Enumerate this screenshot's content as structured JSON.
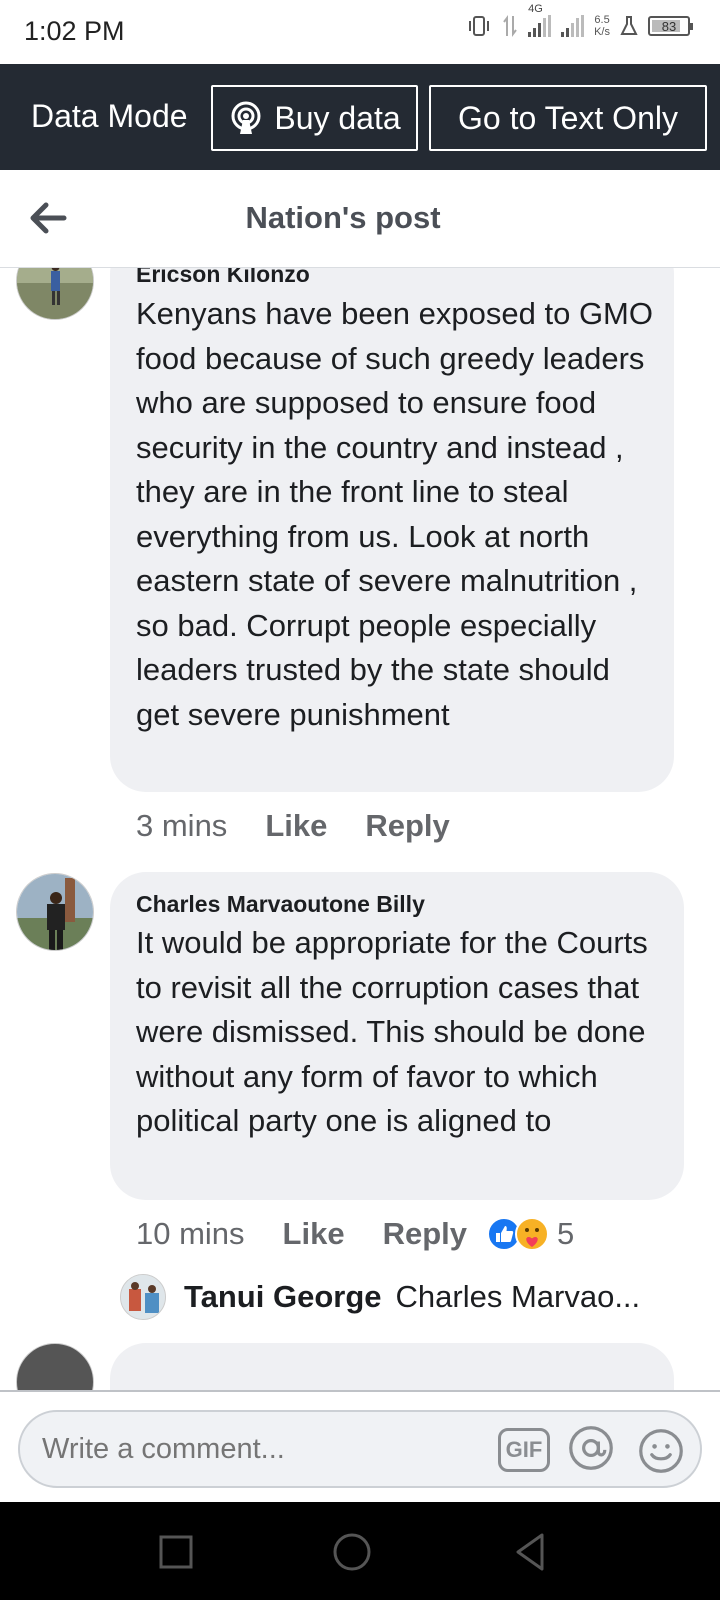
{
  "status_bar": {
    "time": "1:02 PM",
    "network": "4G",
    "speed_value": "6.5",
    "speed_unit": "K/s",
    "battery": "83",
    "battery_level": 0.83
  },
  "data_banner": {
    "mode_label": "Data Mode",
    "buy_label": "Buy data",
    "text_only_label": "Go to Text Only"
  },
  "header": {
    "title": "Nation's post"
  },
  "comments": [
    {
      "author": "Ericson Kilonzo",
      "text": "Kenyans have been exposed to GMO food because of such greedy leaders who are supposed to ensure food security in the country and instead , they are in the front line to steal everything from us. Look at north eastern state of severe malnutrition , so bad. Corrupt people especially leaders trusted by the state should get severe punishment",
      "time": "3 mins",
      "like_label": "Like",
      "reply_label": "Reply"
    },
    {
      "author": "Charles Marvaoutone Billy",
      "text": "It would be appropriate for the Courts to revisit all the corruption cases that were dismissed. This should be done without any form of favor to which political party one is aligned to",
      "time": "10 mins",
      "like_label": "Like",
      "reply_label": "Reply",
      "reaction_count": "5",
      "reactions": [
        "like-icon",
        "care-icon"
      ],
      "reply_preview": {
        "author": "Tanui George",
        "snippet": "Charles Marvao..."
      }
    }
  ],
  "composer": {
    "placeholder": "Write a comment...",
    "gif_label": "GIF"
  },
  "colors": {
    "banner_bg": "#242a33",
    "bubble_bg": "#eff0f3",
    "like_blue": "#1877f2"
  }
}
